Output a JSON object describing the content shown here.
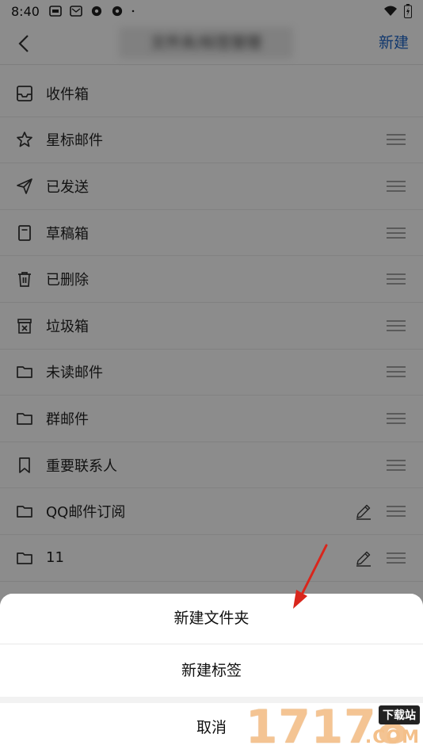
{
  "status_bar": {
    "time": "8:40"
  },
  "header": {
    "title": "文件夹/标签管理",
    "new_label": "新建"
  },
  "list": [
    {
      "label": "收件箱",
      "icon": "inbox-icon"
    },
    {
      "label": "星标邮件",
      "icon": "star-icon"
    },
    {
      "label": "已发送",
      "icon": "send-icon"
    },
    {
      "label": "草稿箱",
      "icon": "draft-icon"
    },
    {
      "label": "已删除",
      "icon": "trash-icon"
    },
    {
      "label": "垃圾箱",
      "icon": "spam-icon"
    },
    {
      "label": "未读邮件",
      "icon": "folder-icon"
    },
    {
      "label": "群邮件",
      "icon": "folder-icon"
    },
    {
      "label": "重要联系人",
      "icon": "bookmark-icon"
    },
    {
      "label": "QQ邮件订阅",
      "icon": "folder-icon"
    },
    {
      "label": "11",
      "icon": "folder-icon"
    }
  ],
  "sheet": {
    "new_folder": "新建文件夹",
    "new_tag": "新建标签",
    "cancel": "取消"
  },
  "watermark": {
    "number": "17178",
    "tag": "下载站",
    "domain": ".COM"
  },
  "colors": {
    "accent": "#1f66c8",
    "arrow": "#d9261c"
  }
}
